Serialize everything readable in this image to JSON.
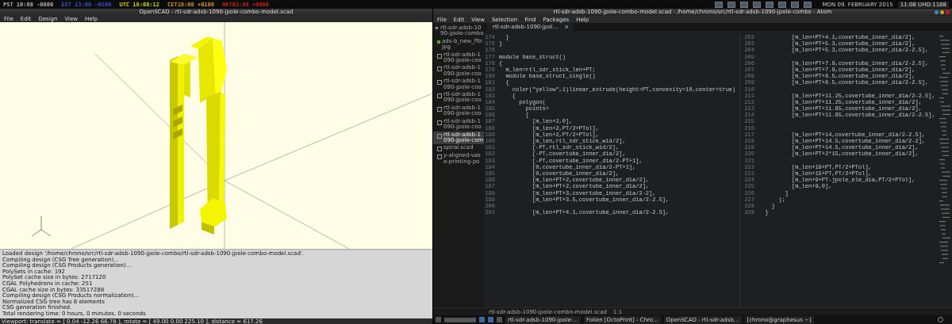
{
  "top_bar": {
    "clocks": [
      {
        "text": "PST 10:08 -0800",
        "color": "#b0b0b0"
      },
      {
        "text": "EST 13:08 -0500",
        "color": "#3a4fd0"
      },
      {
        "text": "UTC 18:08:12",
        "color": "#c8d020"
      },
      {
        "text": "CET19:08 +0100",
        "color": "#d09040"
      },
      {
        "text": "HKT02:08 +0800",
        "color": "#c02020"
      }
    ],
    "date": "MON 09. FEBRUARY 2015",
    "time": "11:08 UHD:1188"
  },
  "openscad": {
    "title": "OpenSCAD - rtl-sdr-adsb-1090-jpole-combo-model.scad",
    "menu": [
      "File",
      "Edit",
      "Design",
      "View",
      "Help"
    ],
    "console": [
      "Loaded design '/home/chrono/src/rtl-sdr-adsb-1090-jpole-combo/rtl-sdr-adsb-1090-jpole-combo-model.scad'.",
      "Compiling design (CSG Tree generation)...",
      "Compiling design (CSG Products generation)...",
      "PolySets in cache: 192",
      "PolySet cache size in bytes: 2717120",
      "CGAL Polyhedrons in cache: 251",
      "CGAL cache size in bytes: 33517288",
      "Compiling design (CSG Products normalization)...",
      "Normalized CSG tree has 8 elements",
      "CSG generation finished.",
      "Total rendering time: 0 hours, 0 minutes, 0 seconds"
    ],
    "status": "Viewport: translate = [ 0.04 -12.26 66.78 ], rotate = [ 49.00 0.00 225.10 ], distance = 617.26"
  },
  "atom": {
    "title": "rtl-sdr-adsb-1090-jpole-combo-model.scad - /home/chrono/src/rtl-sdr-adsb-1090-jpole-combo - Atom",
    "menu": [
      "File",
      "Edit",
      "View",
      "Selection",
      "Find",
      "Packages",
      "Help"
    ],
    "tree": {
      "name": "rtl-sdr-adsb-1090-jpole-combo",
      "expanded": true,
      "children": [
        {
          "name": "ads-b_new_fltr.jpg",
          "kind": "image",
          "selected": false
        },
        {
          "name": "rtl-sdr-adsb-1090-jpole-coo",
          "kind": "file",
          "selected": false
        },
        {
          "name": "rtl-sdr-adsb-1090-jpole-coo",
          "kind": "file",
          "selected": false
        },
        {
          "name": "rtl-sdr-adsb-1090-jpole-coo",
          "kind": "file",
          "selected": false
        },
        {
          "name": "rtl-sdr-adsb-1090-jpole-coo",
          "kind": "file",
          "selected": false
        },
        {
          "name": "rtl-sdr-adsb-1090-jpole-coo",
          "kind": "file",
          "selected": false
        },
        {
          "name": "rtl-sdr-adsb-1090-jpole-coo",
          "kind": "file",
          "selected": false
        },
        {
          "name": "rtl-sdr-adsb-1090-jpole-com",
          "kind": "file",
          "selected": true
        },
        {
          "name": "spiral.scad",
          "kind": "file",
          "selected": false
        },
        {
          "name": "y-aligned-vase-printing-po",
          "kind": "file",
          "selected": false
        }
      ]
    },
    "tab": {
      "label": "rtl-sdr-adsb-1090-jpol...",
      "close": "×"
    },
    "lines": [
      {
        "number": "174",
        "text": "  }"
      },
      {
        "number": "175",
        "text": "}"
      },
      {
        "number": "176"
      },
      {
        "number": "177",
        "text": "module base_struct()"
      },
      {
        "number": "178",
        "text": "{"
      },
      {
        "number": "179",
        "text": "  m_len=rtl_sdr_stick_len+PT;"
      },
      {
        "number": "180",
        "text": "  module base_struct_single()"
      },
      {
        "number": "181",
        "text": "  {"
      },
      {
        "number": "182",
        "text": "    color(\"yellow\",1)linear_extrude(height=PT,convexity=10,center=true)"
      },
      {
        "number": "183",
        "text": "    {"
      },
      {
        "number": "184",
        "text": "      polygon("
      },
      {
        "number": "185",
        "text": "        points="
      },
      {
        "number": "186",
        "text": "        ["
      },
      {
        "number": "187",
        "text": "          [m_len+2,0],"
      },
      {
        "number": "188",
        "text": "          [m_len+2,PT/2+PTol],"
      },
      {
        "number": "189",
        "text": "          [m_len+2,PT/2+PTol],"
      },
      {
        "number": "190",
        "text": "          [m_len,rtl_sdr_stick_wid/2],"
      },
      {
        "number": "191",
        "text": "          [-PT,rtl_sdr_stick_wid/2],"
      },
      {
        "number": "192",
        "text": "          [-PT,covertube_inner_dia/2],"
      },
      {
        "number": "193",
        "text": "          [-PT,covertube_inner_dia/2-PT+1],"
      },
      {
        "number": "194",
        "text": "          [0,covertube_inner_dia/2-PT+1],"
      },
      {
        "number": "195",
        "text": "          [0,covertube_inner_dia/2],"
      },
      {
        "number": "196",
        "text": "          [m_len+PT+2,covertube_inner_dia/2],"
      },
      {
        "number": "197",
        "text": "          [m_len+PT+2,covertube_inner_dia/2],"
      },
      {
        "number": "198",
        "text": "          [m_len+PT+3,covertube_inner_dia/2-2],"
      },
      {
        "number": "199",
        "text": "          [m_len+PT+3.5,covertube_inner_dia/2-2.5],"
      },
      {
        "number": "200"
      },
      {
        "number": "201",
        "text": "          [m_len+PT+4.1,covertube_inner_dia/2-2.5],"
      },
      {
        "number": "202",
        "text": "          [m_len+PT+4.1,covertube_inner_dia/2],"
      },
      {
        "number": "203",
        "text": "          [m_len+PT+5.3,covertube_inner_dia/2],"
      },
      {
        "number": "204",
        "text": "          [m_len+PT+5.3,covertube_inner_dia/2-2.5],"
      },
      {
        "number": "205"
      },
      {
        "number": "206",
        "text": "          [m_len+PT+7.9,covertube_inner_dia/2-2.5],"
      },
      {
        "number": "207",
        "text": "          [m_len+PT+7.9,covertube_inner_dia/2],"
      },
      {
        "number": "208",
        "text": "          [m_len+PT+8.5,covertube_inner_dia/2],"
      },
      {
        "number": "209",
        "text": "          [m_len+PT+8.5,covertube_inner_dia/2-2.5],"
      },
      {
        "number": "210"
      },
      {
        "number": "211",
        "text": "          [m_len+PT+11.25,covertube_inner_dia/2-2.5],"
      },
      {
        "number": "212",
        "text": "          [m_len+PT+11.25,covertube_inner_dia/2],"
      },
      {
        "number": "213",
        "text": "          [m_len+PT+11.85,covertube_inner_dia/2],"
      },
      {
        "number": "214",
        "text": "          [m_len+PT+11.85,covertube_inner_dia/2-2.5],"
      },
      {
        "number": "215"
      },
      {
        "number": "216"
      },
      {
        "number": "217",
        "text": "          [m_len+PT+14,covertube_inner_dia/2-2.5],"
      },
      {
        "number": "218",
        "text": "          [m_len+PT+14.5,covertube_inner_dia/2-2],"
      },
      {
        "number": "219",
        "text": "          [m_len+PT+14.5,covertube_inner_dia/2],"
      },
      {
        "number": "220",
        "text": "          [m_len+PT+2*15,covertube_inner_dia/2],"
      },
      {
        "number": "221"
      },
      {
        "number": "222",
        "text": "          [m_len+19+PT,PT/2+PTol],"
      },
      {
        "number": "223",
        "text": "          [m_len+15+PT,PT/2+PTol],"
      },
      {
        "number": "224",
        "text": "          [m_len+9+PT-jpole_ele_dia,PT/2+PTol],"
      },
      {
        "number": "225",
        "text": "          [m_len+9,0],"
      },
      {
        "number": "226",
        "text": "        ]"
      },
      {
        "number": "227",
        "text": "      );"
      },
      {
        "number": "228",
        "text": "    }"
      },
      {
        "number": "229",
        "text": "  }"
      }
    ],
    "status": {
      "file": "rtl-sdr-adsb-1090-jpole-combo-model.scad",
      "position": "1:1"
    }
  },
  "taskbar": {
    "items": [
      "rtl-sdr-adsb-1090-jpole-...",
      "Folien [OctoPrint] - Chro...",
      "OpenSCAD - rtl-sdr-adsb...",
      "[chrono@graphesus ~]"
    ]
  }
}
